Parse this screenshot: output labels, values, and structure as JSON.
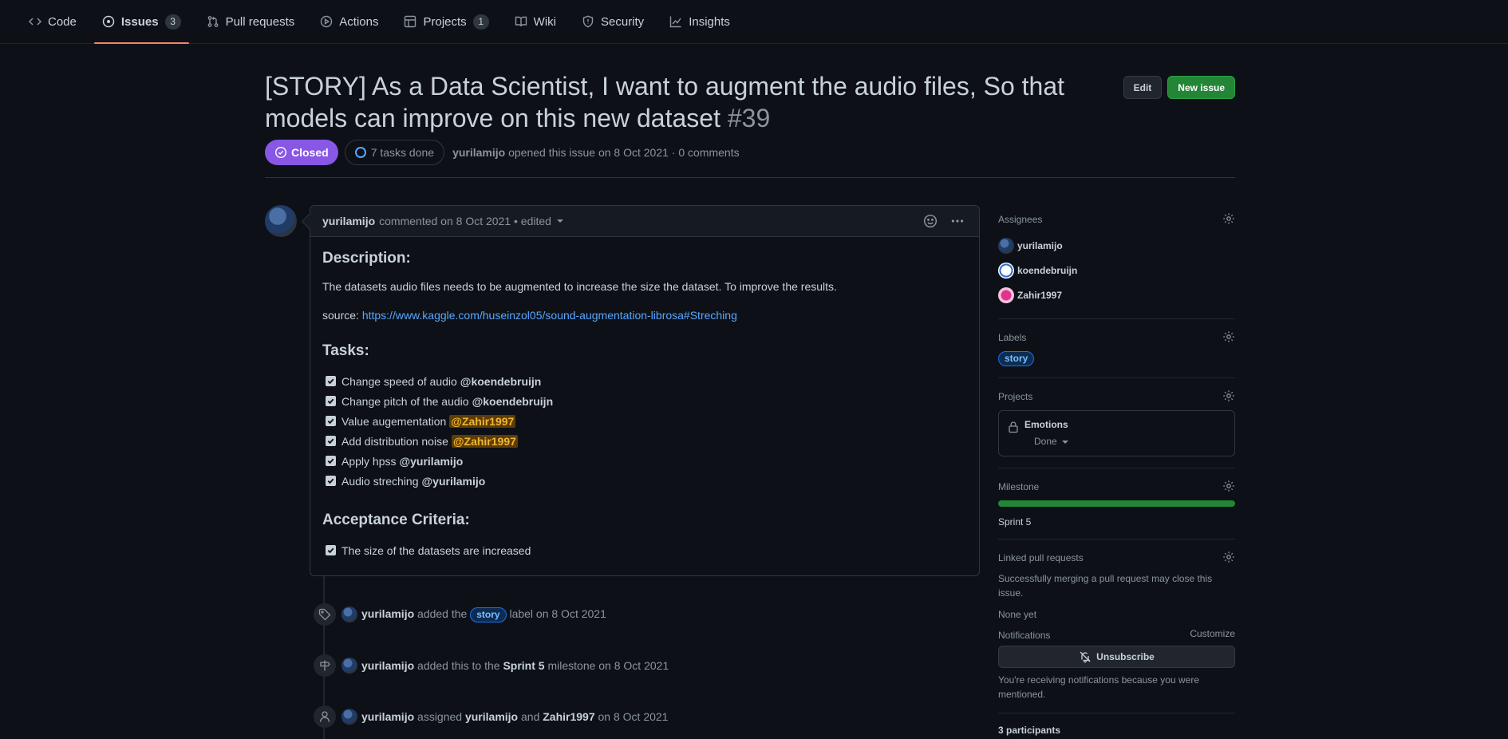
{
  "nav": {
    "items": [
      {
        "label": "Code",
        "icon": "code-icon"
      },
      {
        "label": "Issues",
        "icon": "issue-opened-icon",
        "count": "3"
      },
      {
        "label": "Pull requests",
        "icon": "git-pull-request-icon"
      },
      {
        "label": "Actions",
        "icon": "play-icon"
      },
      {
        "label": "Projects",
        "icon": "table-icon",
        "count": "1"
      },
      {
        "label": "Wiki",
        "icon": "book-icon"
      },
      {
        "label": "Security",
        "icon": "shield-icon"
      },
      {
        "label": "Insights",
        "icon": "graph-icon"
      }
    ]
  },
  "issue": {
    "title": "[STORY] As a Data Scientist, I want to augment the audio files, So that models can improve on this new dataset",
    "number": "#39",
    "edit_label": "Edit",
    "new_issue_label": "New issue",
    "state": "Closed",
    "tasks_done": "7 tasks done",
    "author": "yurilamijo",
    "opened_text": "opened this issue on 8 Oct 2021 · 0 comments"
  },
  "comment": {
    "author": "yurilamijo",
    "meta": "commented on 8 Oct 2021 • edited",
    "description_heading": "Description:",
    "description_text": "The datasets audio files needs to be augmented to increase the size the dataset. To improve the results.",
    "source_label": "source:",
    "source_link": "https://www.kaggle.com/huseinzol05/sound-augmentation-librosa#Streching",
    "tasks_heading": "Tasks:",
    "tasks": [
      {
        "text": "Change speed of audio",
        "mention": "@koendebruijn",
        "highlight": false
      },
      {
        "text": "Change pitch of the audio",
        "mention": "@koendebruijn",
        "highlight": false
      },
      {
        "text": "Value augementation",
        "mention": "@Zahir1997",
        "highlight": true
      },
      {
        "text": "Add distribution noise",
        "mention": "@Zahir1997",
        "highlight": true
      },
      {
        "text": "Apply hpss",
        "mention": "@yurilamijo",
        "highlight": false
      },
      {
        "text": "Audio streching",
        "mention": "@yurilamijo",
        "highlight": false
      }
    ],
    "acceptance_heading": "Acceptance Criteria:",
    "acceptance": [
      {
        "text": "The size of the datasets are increased"
      }
    ]
  },
  "timeline": {
    "label_event": {
      "actor": "yurilamijo",
      "pre": "added the",
      "label": "story",
      "post": "label on 8 Oct 2021"
    },
    "milestone_event": {
      "actor": "yurilamijo",
      "pre": "added this to the",
      "milestone": "Sprint 5",
      "post": "milestone on 8 Oct 2021"
    },
    "assign_event": {
      "actor": "yurilamijo",
      "pre": "assigned",
      "a1": "yurilamijo",
      "and": "and",
      "a2": "Zahir1997",
      "post": "on 8 Oct 2021"
    }
  },
  "sidebar": {
    "assignees_title": "Assignees",
    "assignees": [
      "yurilamijo",
      "koendebruijn",
      "Zahir1997"
    ],
    "labels_title": "Labels",
    "label": "story",
    "projects_title": "Projects",
    "project_name": "Emotions",
    "project_status": "Done",
    "milestone_title": "Milestone",
    "milestone_name": "Sprint 5",
    "milestone_progress": 1.0,
    "linked_title": "Linked pull requests",
    "linked_hint": "Successfully merging a pull request may close this issue.",
    "linked_none": "None yet",
    "notifications_title": "Notifications",
    "customize_label": "Customize",
    "unsubscribe_label": "Unsubscribe",
    "notifications_reason": "You're receiving notifications because you were mentioned.",
    "participants": "3 participants"
  },
  "colors": {
    "closed": "#8957e5",
    "primary": "#238636",
    "link": "#58a6ff",
    "nav_underline": "#f78166"
  }
}
